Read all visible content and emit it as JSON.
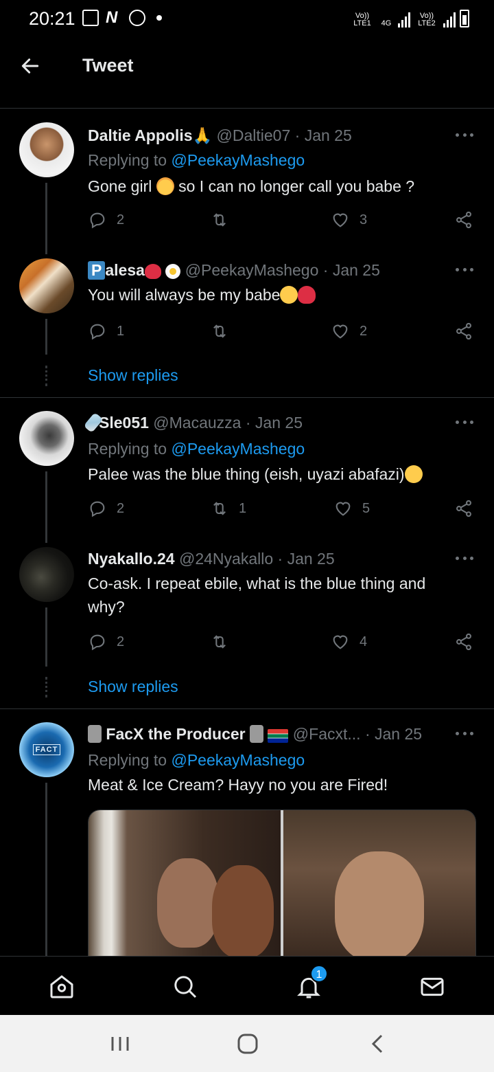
{
  "status_bar": {
    "time": "20:21",
    "sim1_label": "Vo)) LTE1",
    "net_label": "4G",
    "sim2_label": "Vo)) LTE2",
    "battery_label": "7"
  },
  "header": {
    "title": "Tweet"
  },
  "tweets": [
    {
      "name": "Daltie Appolis",
      "name_emoji": "🙏",
      "handle": "@Daltie07",
      "date": "· Jan 25",
      "replying_prefix": "Replying to",
      "replying_to": "@PeekayMashego",
      "text_a": "Gone girl",
      "text_b": "so I can no longer call you babe ?",
      "replies": "2",
      "retweets": "",
      "likes": "3"
    },
    {
      "name_badge": "P",
      "name": "alesa",
      "handle": "@PeekayMashego",
      "date": "· Jan 25",
      "text": "You will always be my babe",
      "replies": "1",
      "retweets": "",
      "likes": "2",
      "show_replies": "Show replies"
    },
    {
      "name": "Sle051",
      "handle": "@Macauzza",
      "date": "· Jan 25",
      "replying_prefix": "Replying to",
      "replying_to": "@PeekayMashego",
      "text": "Palee was the blue thing (eish, uyazi abafazi)",
      "replies": "2",
      "retweets": "1",
      "likes": "5"
    },
    {
      "name": "Nyakallo.24",
      "handle": "@24Nyakallo",
      "date": "· Jan 25",
      "text": "Co-ask. I repeat ebile, what is the blue thing and why?",
      "replies": "2",
      "retweets": "",
      "likes": "4",
      "show_replies": "Show replies"
    },
    {
      "name": "FacX the Producer",
      "handle": "@Facxt...",
      "date": "· Jan 25",
      "replying_prefix": "Replying to",
      "replying_to": "@PeekayMashego",
      "text": "Meat & Ice Cream? Hayy no you are Fired!",
      "avatar_text": "FACT"
    }
  ],
  "bottom_nav": {
    "items": [
      "home-icon",
      "search-icon",
      "notifications-icon",
      "messages-icon"
    ],
    "notification_count": "1"
  },
  "colors": {
    "accent": "#1d9bf0",
    "background": "#000000",
    "muted": "#71767b",
    "text": "#e7e9ea",
    "like_heart": "#e0245e"
  }
}
